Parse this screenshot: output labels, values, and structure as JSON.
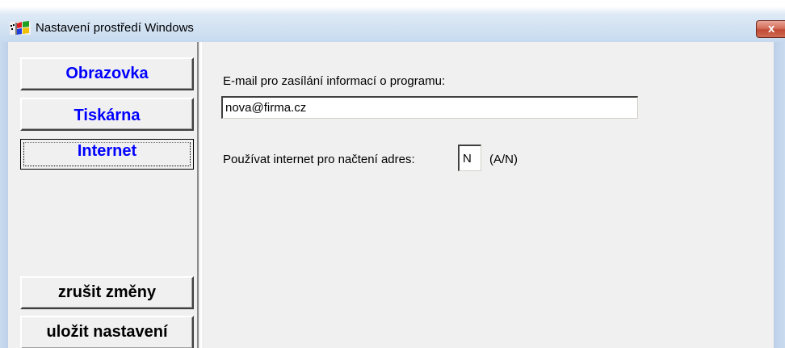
{
  "window": {
    "title": "Nastavení prostředí Windows",
    "close_label": "x",
    "icon": "windows-flag-icon"
  },
  "nav": {
    "items": [
      {
        "label": "Obrazovka"
      },
      {
        "label": "Tiskárna"
      },
      {
        "label": "Internet",
        "selected": true
      }
    ],
    "cancel_label": "zrušit změny",
    "save_label": "uložit nastavení"
  },
  "internet": {
    "email_label": "E-mail pro zasílání informací o programu:",
    "email_value": "nova@firma.cz",
    "use_internet_label": "Používat internet pro načtení adres:",
    "use_internet_value": "N",
    "use_internet_hint": "(A/N)"
  },
  "colors": {
    "nav_text": "#0000ff",
    "face": "#f0f0f0",
    "close_button": "#c75a45"
  }
}
